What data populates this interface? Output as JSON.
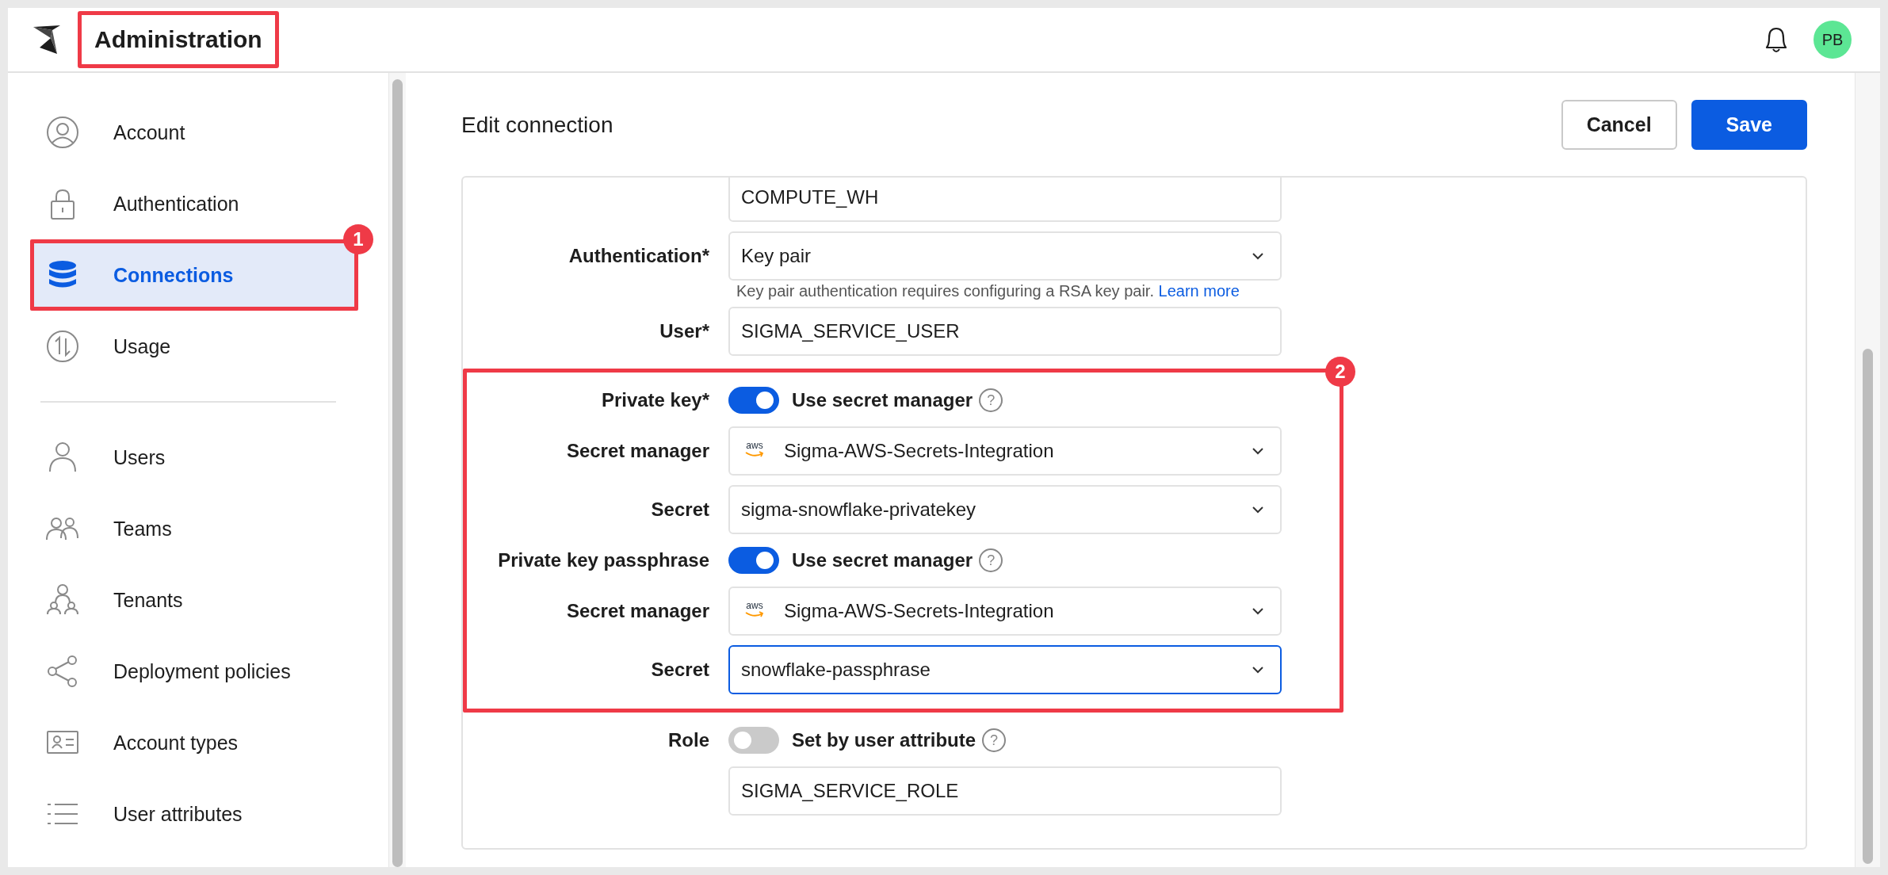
{
  "header": {
    "title": "Administration",
    "title_framed": true,
    "avatar": "PB"
  },
  "sidebar": {
    "groups": [
      [
        {
          "kind": "account",
          "label": "Account",
          "selected": false
        },
        {
          "kind": "lock",
          "label": "Authentication",
          "selected": false
        },
        {
          "kind": "database",
          "label": "Connections",
          "selected": true,
          "callout": "1"
        },
        {
          "kind": "usage",
          "label": "Usage",
          "selected": false
        }
      ],
      [
        {
          "kind": "user",
          "label": "Users",
          "selected": false
        },
        {
          "kind": "team",
          "label": "Teams",
          "selected": false
        },
        {
          "kind": "tenant",
          "label": "Tenants",
          "selected": false
        },
        {
          "kind": "share",
          "label": "Deployment policies",
          "selected": false
        },
        {
          "kind": "card",
          "label": "Account types",
          "selected": false
        },
        {
          "kind": "list",
          "label": "User attributes",
          "selected": false
        }
      ]
    ]
  },
  "main": {
    "title": "Edit connection",
    "buttons": [
      {
        "kind": "secondary",
        "label": "Cancel"
      },
      {
        "kind": "primary",
        "label": "Save"
      }
    ]
  },
  "form": {
    "sections": [
      {
        "rows": [
          {
            "kind": "text",
            "value": "COMPUTE_WH"
          },
          {
            "kind": "select",
            "label": "Authentication*",
            "value": "Key pair",
            "focused": false
          },
          {
            "kind": "note",
            "text": "Key pair authentication requires configuring a RSA key pair.",
            "link": "Learn more"
          },
          {
            "kind": "text",
            "label": "User*",
            "value": "SIGMA_SERVICE_USER"
          }
        ]
      },
      {
        "callout": "2",
        "rows": [
          {
            "kind": "toggle",
            "label": "Private key*",
            "on": true,
            "text": "Use secret manager",
            "help": "?"
          },
          {
            "kind": "provider-select",
            "label": "Secret manager",
            "provider": "aws",
            "value": "Sigma-AWS-Secrets-Integration",
            "focused": false
          },
          {
            "kind": "select",
            "label": "Secret",
            "value": "sigma-snowflake-privatekey",
            "focused": false
          },
          {
            "kind": "toggle",
            "label": "Private key passphrase",
            "on": true,
            "text": "Use secret manager",
            "help": "?"
          },
          {
            "kind": "provider-select",
            "label": "Secret manager",
            "provider": "aws",
            "value": "Sigma-AWS-Secrets-Integration",
            "focused": false
          },
          {
            "kind": "select",
            "label": "Secret",
            "value": "snowflake-passphrase",
            "focused": true
          }
        ]
      },
      {
        "rows": [
          {
            "kind": "toggle",
            "label": "Role",
            "on": false,
            "text": "Set by user attribute",
            "help": "?"
          },
          {
            "kind": "text",
            "value": "SIGMA_SERVICE_ROLE"
          }
        ]
      }
    ]
  }
}
